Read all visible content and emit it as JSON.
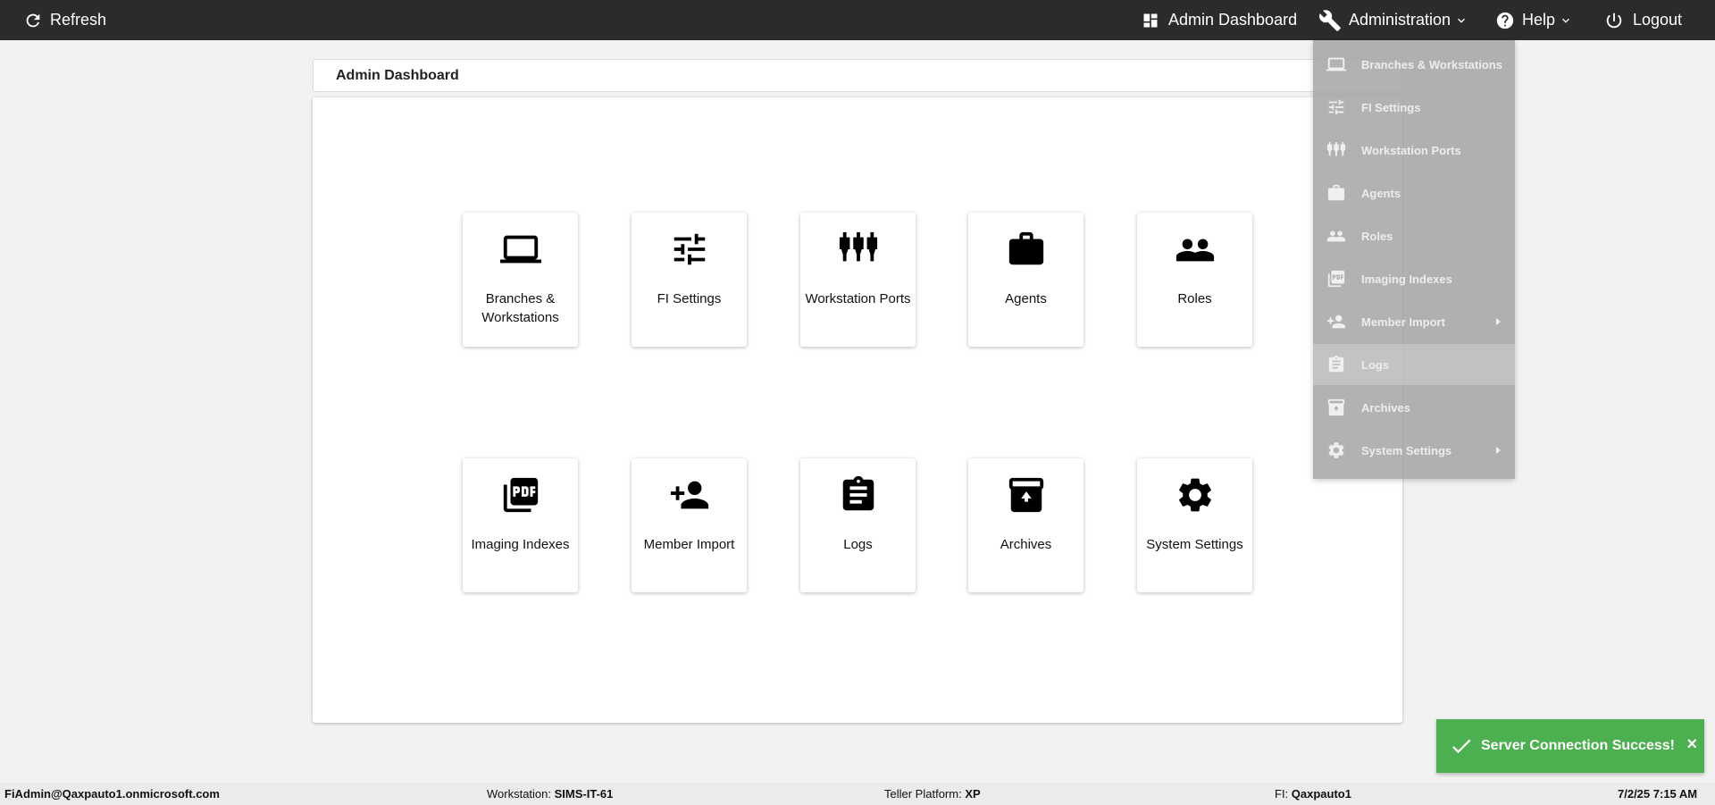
{
  "topbar": {
    "refresh_label": "Refresh",
    "admin_dashboard_label": "Admin Dashboard",
    "administration_label": "Administration",
    "help_label": "Help",
    "logout_label": "Logout"
  },
  "page": {
    "title": "Admin Dashboard"
  },
  "tiles": [
    {
      "label": "Branches & Workstations",
      "icon": "laptop-icon"
    },
    {
      "label": "FI Settings",
      "icon": "sliders-icon"
    },
    {
      "label": "Workstation Ports",
      "icon": "ports-icon"
    },
    {
      "label": "Agents",
      "icon": "briefcase-icon"
    },
    {
      "label": "Roles",
      "icon": "people-icon"
    },
    {
      "label": "Imaging Indexes",
      "icon": "pdf-icon"
    },
    {
      "label": "Member Import",
      "icon": "person-add-icon"
    },
    {
      "label": "Logs",
      "icon": "clipboard-icon"
    },
    {
      "label": "Archives",
      "icon": "archive-icon"
    },
    {
      "label": "System Settings",
      "icon": "gear-icon"
    }
  ],
  "administration_menu": {
    "items": [
      {
        "label": "Branches & Workstations",
        "icon": "laptop-icon"
      },
      {
        "label": "FI Settings",
        "icon": "sliders-icon"
      },
      {
        "label": "Workstation Ports",
        "icon": "ports-icon"
      },
      {
        "label": "Agents",
        "icon": "briefcase-icon"
      },
      {
        "label": "Roles",
        "icon": "people-icon"
      },
      {
        "label": "Imaging Indexes",
        "icon": "pdf-icon"
      },
      {
        "label": "Member Import",
        "icon": "person-add-icon",
        "has_submenu": true
      },
      {
        "label": "Logs",
        "icon": "clipboard-icon",
        "highlighted": true
      },
      {
        "label": "Archives",
        "icon": "archive-icon"
      },
      {
        "label": "System Settings",
        "icon": "gear-icon",
        "has_submenu": true
      }
    ]
  },
  "toast": {
    "message": "Server Connection Success!",
    "close_glyph": "×",
    "color": "#4caf50"
  },
  "statusbar": {
    "user": "FiAdmin@Qaxpauto1.onmicrosoft.com",
    "workstation_label": "Workstation:",
    "workstation_value": "SIMS-IT-61",
    "teller_label": "Teller Platform:",
    "teller_value": "XP",
    "fi_label": "FI:",
    "fi_value": "Qaxpauto1",
    "datetime": "7/2/25 7:15 AM"
  },
  "colors": {
    "topbar": "#2b2b2b",
    "background": "#f2f2f2",
    "menu_overlay": "#a5a5a5"
  }
}
